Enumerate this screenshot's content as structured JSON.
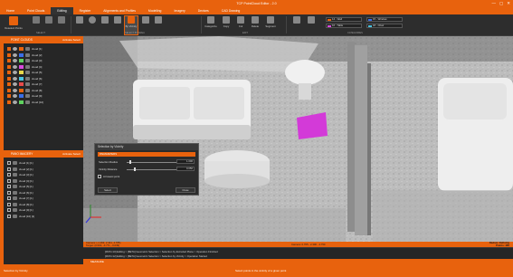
{
  "window": {
    "title": "TCP PointCloud Editor - 2.0",
    "controls": [
      "—",
      "▢",
      "✕"
    ]
  },
  "menu_tabs": [
    "Home",
    "Point Clouds",
    "Editing",
    "Register",
    "Alignments and Profiles",
    "Modelling",
    "Imagery",
    "Devices",
    "CAD Drawing"
  ],
  "active_tab": "Editing",
  "ribbon": {
    "groups": {
      "select": "SELECT",
      "select_by_area": "SELECT BY AREA",
      "edit": "EDIT",
      "categories": "CATEGORIES"
    },
    "buttons": {
      "deselect": "Deselect Points",
      "select_by_vicinity": "By Vicinity",
      "categorize": "Categorize",
      "copy": "Copy",
      "cut": "Cut",
      "delete": "Delete",
      "segment": "Segment"
    },
    "categories": [
      {
        "label": "14 - Wall",
        "color": "#e8620d"
      },
      {
        "label": "15 - Window",
        "color": "#3a6ee8"
      },
      {
        "label": "16 - Table",
        "color": "#d94adf"
      },
      {
        "label": "18 - Chair",
        "color": "#4ac3df"
      }
    ]
  },
  "panels": {
    "point_clouds": {
      "title": "POINT CLOUDS",
      "tools": "Activate  Select",
      "items": [
        {
          "label": "cloud [1]",
          "color": "#e8620d"
        },
        {
          "label": "cloud [2]",
          "color": "#3a6ee8"
        },
        {
          "label": "cloud [3]",
          "color": "#5fd35f"
        },
        {
          "label": "cloud [4]",
          "color": "#d94adf"
        },
        {
          "label": "cloud [5]",
          "color": "#e8d84a"
        },
        {
          "label": "cloud [6]",
          "color": "#4ac3df"
        },
        {
          "label": "cloud [7]",
          "color": "#e84a4a"
        },
        {
          "label": "cloud [8]",
          "color": "#e8620d"
        },
        {
          "label": "cloud [9]",
          "color": "#3a6ee8"
        },
        {
          "label": "cloud [10]",
          "color": "#5fd35f"
        }
      ]
    },
    "pano_imagery": {
      "title": "PANO IMAGERY",
      "tools": "Activate  Select",
      "items": [
        "cloud [1] [1]",
        "cloud [2] [1]",
        "cloud [3] [1]",
        "cloud [4] [1]",
        "cloud [5] [1]",
        "cloud [6] [1]",
        "cloud [7] [1]",
        "cloud [8] [1]",
        "cloud [9] [1]",
        "cloud [10] [1]"
      ]
    }
  },
  "dialog": {
    "title": "Selection by Vicinity",
    "section": "PARAMETERS",
    "radius_label": "Selection Radius",
    "radius_value": "1.000",
    "distance_label": "Vicinity Distance",
    "distance_value": "0.050",
    "radius_fraction": 0.05,
    "distance_fraction": 0.15,
    "lowest_point_label": "At lowest point",
    "apply_label": "Select",
    "close_label": "Close"
  },
  "viewport_status": {
    "camera_line1": "Camera: (-1.263, 2.341, 4.785)",
    "camera_line2": "Target: (0.000, -0.771, -0.039)",
    "center": "Camera: 0.765 - 2.300 - 4.750",
    "right_line1": "Radius: Defining",
    "right_line2": "Points: 485"
  },
  "log": [
    "[09:51:10] Editing > [BETA] Geometric Selection > Selection by Extruded Plane > Operation Finished",
    "[09:51:12] Editing > [BETA] Geometric Selection > Selection by Vicinity > Operation Started"
  ],
  "measure_title": "MEASURE",
  "status": {
    "left": "Selection by Vicinity",
    "center": "Select points in the vicinity of a given point"
  }
}
